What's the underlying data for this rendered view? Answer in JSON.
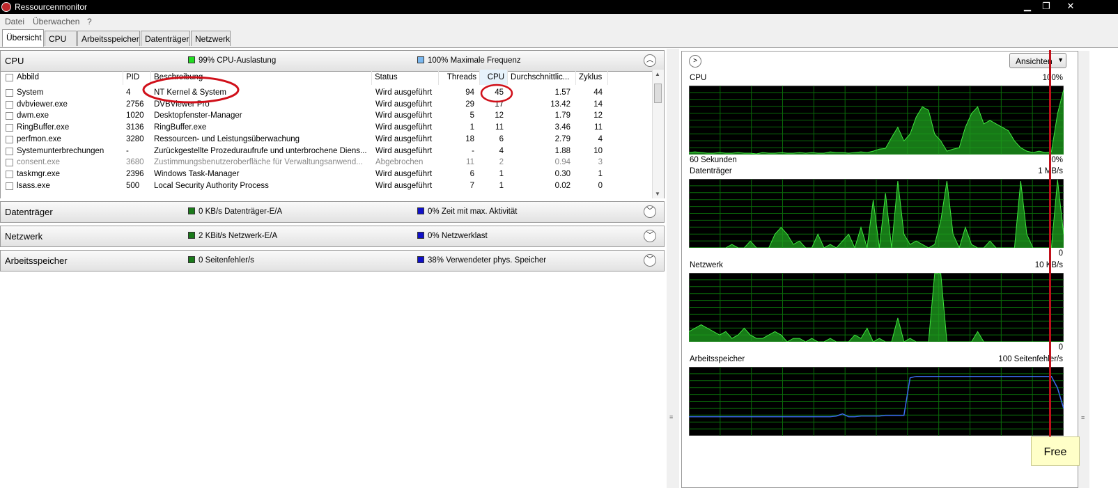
{
  "window": {
    "title": "Ressourcenmonitor",
    "buttons": [
      "▁",
      "❐",
      "✕"
    ]
  },
  "menu": [
    "Datei",
    "Überwachen",
    "?"
  ],
  "tabs": [
    "Übersicht",
    "CPU",
    "Arbeitsspeicher",
    "Datenträger",
    "Netzwerk"
  ],
  "cpu_section": {
    "title": "CPU",
    "metric1": "99% CPU-Auslastung",
    "metric2": "100% Maximale Frequenz",
    "metric1_color": "#22dd22",
    "metric2_color": "#7ab8f0"
  },
  "table": {
    "columns": [
      "Abbild",
      "PID",
      "Beschreibung",
      "Status",
      "Threads",
      "CPU",
      "Durchschnittlic...",
      "Zyklus"
    ],
    "rows": [
      {
        "abbild": "System",
        "pid": "4",
        "beschreibung": "NT Kernel & System",
        "status": "Wird ausgeführt",
        "threads": "94",
        "cpu": "45",
        "avg": "1.57",
        "zyklus": "44",
        "grey": false
      },
      {
        "abbild": "dvbviewer.exe",
        "pid": "2756",
        "beschreibung": "DVBViewer Pro",
        "status": "Wird ausgeführt",
        "threads": "29",
        "cpu": "17",
        "avg": "13.42",
        "zyklus": "14",
        "grey": false
      },
      {
        "abbild": "dwm.exe",
        "pid": "1020",
        "beschreibung": "Desktopfenster-Manager",
        "status": "Wird ausgeführt",
        "threads": "5",
        "cpu": "12",
        "avg": "1.79",
        "zyklus": "12",
        "grey": false
      },
      {
        "abbild": "RingBuffer.exe",
        "pid": "3136",
        "beschreibung": "RingBuffer.exe",
        "status": "Wird ausgeführt",
        "threads": "1",
        "cpu": "11",
        "avg": "3.46",
        "zyklus": "11",
        "grey": false
      },
      {
        "abbild": "perfmon.exe",
        "pid": "3280",
        "beschreibung": "Ressourcen- und Leistungsüberwachung",
        "status": "Wird ausgeführt",
        "threads": "18",
        "cpu": "6",
        "avg": "2.79",
        "zyklus": "4",
        "grey": false
      },
      {
        "abbild": "Systemunterbrechungen",
        "pid": "-",
        "beschreibung": "Zurückgestellte Prozeduraufrufe und unterbrochene Diens...",
        "status": "Wird ausgeführt",
        "threads": "-",
        "cpu": "4",
        "avg": "1.88",
        "zyklus": "10",
        "grey": false
      },
      {
        "abbild": "consent.exe",
        "pid": "3680",
        "beschreibung": "Zustimmungsbenutzeroberfläche für Verwaltungsanwend...",
        "status": "Abgebrochen",
        "threads": "11",
        "cpu": "2",
        "avg": "0.94",
        "zyklus": "3",
        "grey": true
      },
      {
        "abbild": "taskmgr.exe",
        "pid": "2396",
        "beschreibung": "Windows Task-Manager",
        "status": "Wird ausgeführt",
        "threads": "6",
        "cpu": "1",
        "avg": "0.30",
        "zyklus": "1",
        "grey": false
      },
      {
        "abbild": "lsass.exe",
        "pid": "500",
        "beschreibung": "Local Security Authority Process",
        "status": "Wird ausgeführt",
        "threads": "7",
        "cpu": "1",
        "avg": "0.02",
        "zyklus": "0",
        "grey": false
      }
    ]
  },
  "sections": [
    {
      "title": "Datenträger",
      "metric1": "0 KB/s Datenträger-E/A",
      "metric2": "0% Zeit mit max. Aktivität",
      "c1": "#1a7a1a",
      "c2": "#1010c8"
    },
    {
      "title": "Netzwerk",
      "metric1": "2 KBit/s Netzwerk-E/A",
      "metric2": "0% Netzwerklast",
      "c1": "#1a7a1a",
      "c2": "#1010c8"
    },
    {
      "title": "Arbeitsspeicher",
      "metric1": "0 Seitenfehler/s",
      "metric2": "38% Verwendeter phys. Speicher",
      "c1": "#1a7a1a",
      "c2": "#1010c8"
    }
  ],
  "right": {
    "view_button": "Ansichten",
    "graphs": [
      {
        "name": "CPU",
        "max": "100%",
        "min_left": "60 Sekunden",
        "min_right": "0%"
      },
      {
        "name": "Datenträger",
        "max": "1 MB/s",
        "min_left": "",
        "min_right": "0"
      },
      {
        "name": "Netzwerk",
        "max": "10 KB/s",
        "min_left": "",
        "min_right": "0"
      },
      {
        "name": "Arbeitsspeicher",
        "max": "100 Seitenfehler/s",
        "min_left": "",
        "min_right": ""
      }
    ],
    "note": "Free"
  },
  "colors": {
    "graph_bg": "#000000",
    "grid": "#0a6a0a",
    "fill": "#1fa21f",
    "line": "#3fe63f",
    "memline": "#3c6cf0",
    "annotation": "#d0101a"
  },
  "chart_data": [
    {
      "type": "area",
      "title": "CPU",
      "ylim": [
        0,
        100
      ],
      "values": [
        3,
        4,
        3,
        2,
        2,
        3,
        2,
        2,
        3,
        2,
        2,
        1,
        3,
        2,
        2,
        3,
        2,
        2,
        3,
        2,
        3,
        2,
        2,
        4,
        3,
        3,
        2,
        3,
        4,
        3,
        5,
        8,
        9,
        25,
        40,
        20,
        30,
        55,
        70,
        65,
        30,
        20,
        5,
        8,
        10,
        40,
        60,
        70,
        45,
        50,
        45,
        40,
        35,
        20,
        10,
        5,
        3,
        5,
        3,
        4,
        60,
        95
      ]
    },
    {
      "type": "area",
      "title": "Datenträger",
      "ylim": [
        0,
        1
      ],
      "values": [
        0,
        0,
        0,
        0,
        0,
        0,
        0,
        0.05,
        0,
        0,
        0.1,
        0,
        0,
        0,
        0.2,
        0.3,
        0.2,
        0.05,
        0.1,
        0,
        0,
        0.2,
        0,
        0.05,
        0,
        0.1,
        0.2,
        0,
        0.3,
        0,
        0.7,
        0,
        0.8,
        0,
        0.98,
        0.2,
        0.05,
        0.1,
        0.05,
        0,
        0.05,
        0.4,
        0.98,
        0.2,
        0,
        0.3,
        0.05,
        0,
        0,
        0.1,
        0,
        0,
        0,
        0,
        0.98,
        0.2,
        0,
        0,
        0,
        0,
        1,
        0.2
      ]
    },
    {
      "type": "area",
      "title": "Netzwerk",
      "ylim": [
        0,
        10
      ],
      "values": [
        1.5,
        2,
        2.5,
        2,
        1.5,
        1,
        1.5,
        0.5,
        1,
        2,
        1,
        0.5,
        0.5,
        1,
        1.5,
        1,
        0,
        0.5,
        0.5,
        0,
        0.5,
        0,
        0,
        0.5,
        0,
        0,
        0,
        1,
        0.5,
        2,
        0,
        0.5,
        0,
        0,
        3.5,
        0,
        0.5,
        0,
        0,
        0,
        10,
        10,
        0,
        0,
        0,
        0,
        0,
        1.5,
        0,
        0,
        0,
        0,
        0,
        0,
        0,
        0,
        0,
        0,
        0,
        0,
        0,
        0
      ]
    },
    {
      "type": "line",
      "title": "Arbeitsspeicher",
      "ylim": [
        0,
        100
      ],
      "values": [
        28,
        28,
        28,
        28,
        28,
        28,
        28,
        28,
        28,
        28,
        28,
        28,
        28,
        28,
        28,
        28,
        28,
        28,
        28,
        28,
        28,
        28,
        28,
        28,
        29,
        32,
        28,
        28,
        29,
        29,
        29,
        29,
        30,
        30,
        30,
        30,
        85,
        87,
        87,
        87,
        87,
        87,
        87,
        87,
        87,
        87,
        87,
        87,
        87,
        87,
        87,
        87,
        87,
        87,
        87,
        87,
        87,
        87,
        87,
        87,
        70,
        40
      ]
    }
  ]
}
